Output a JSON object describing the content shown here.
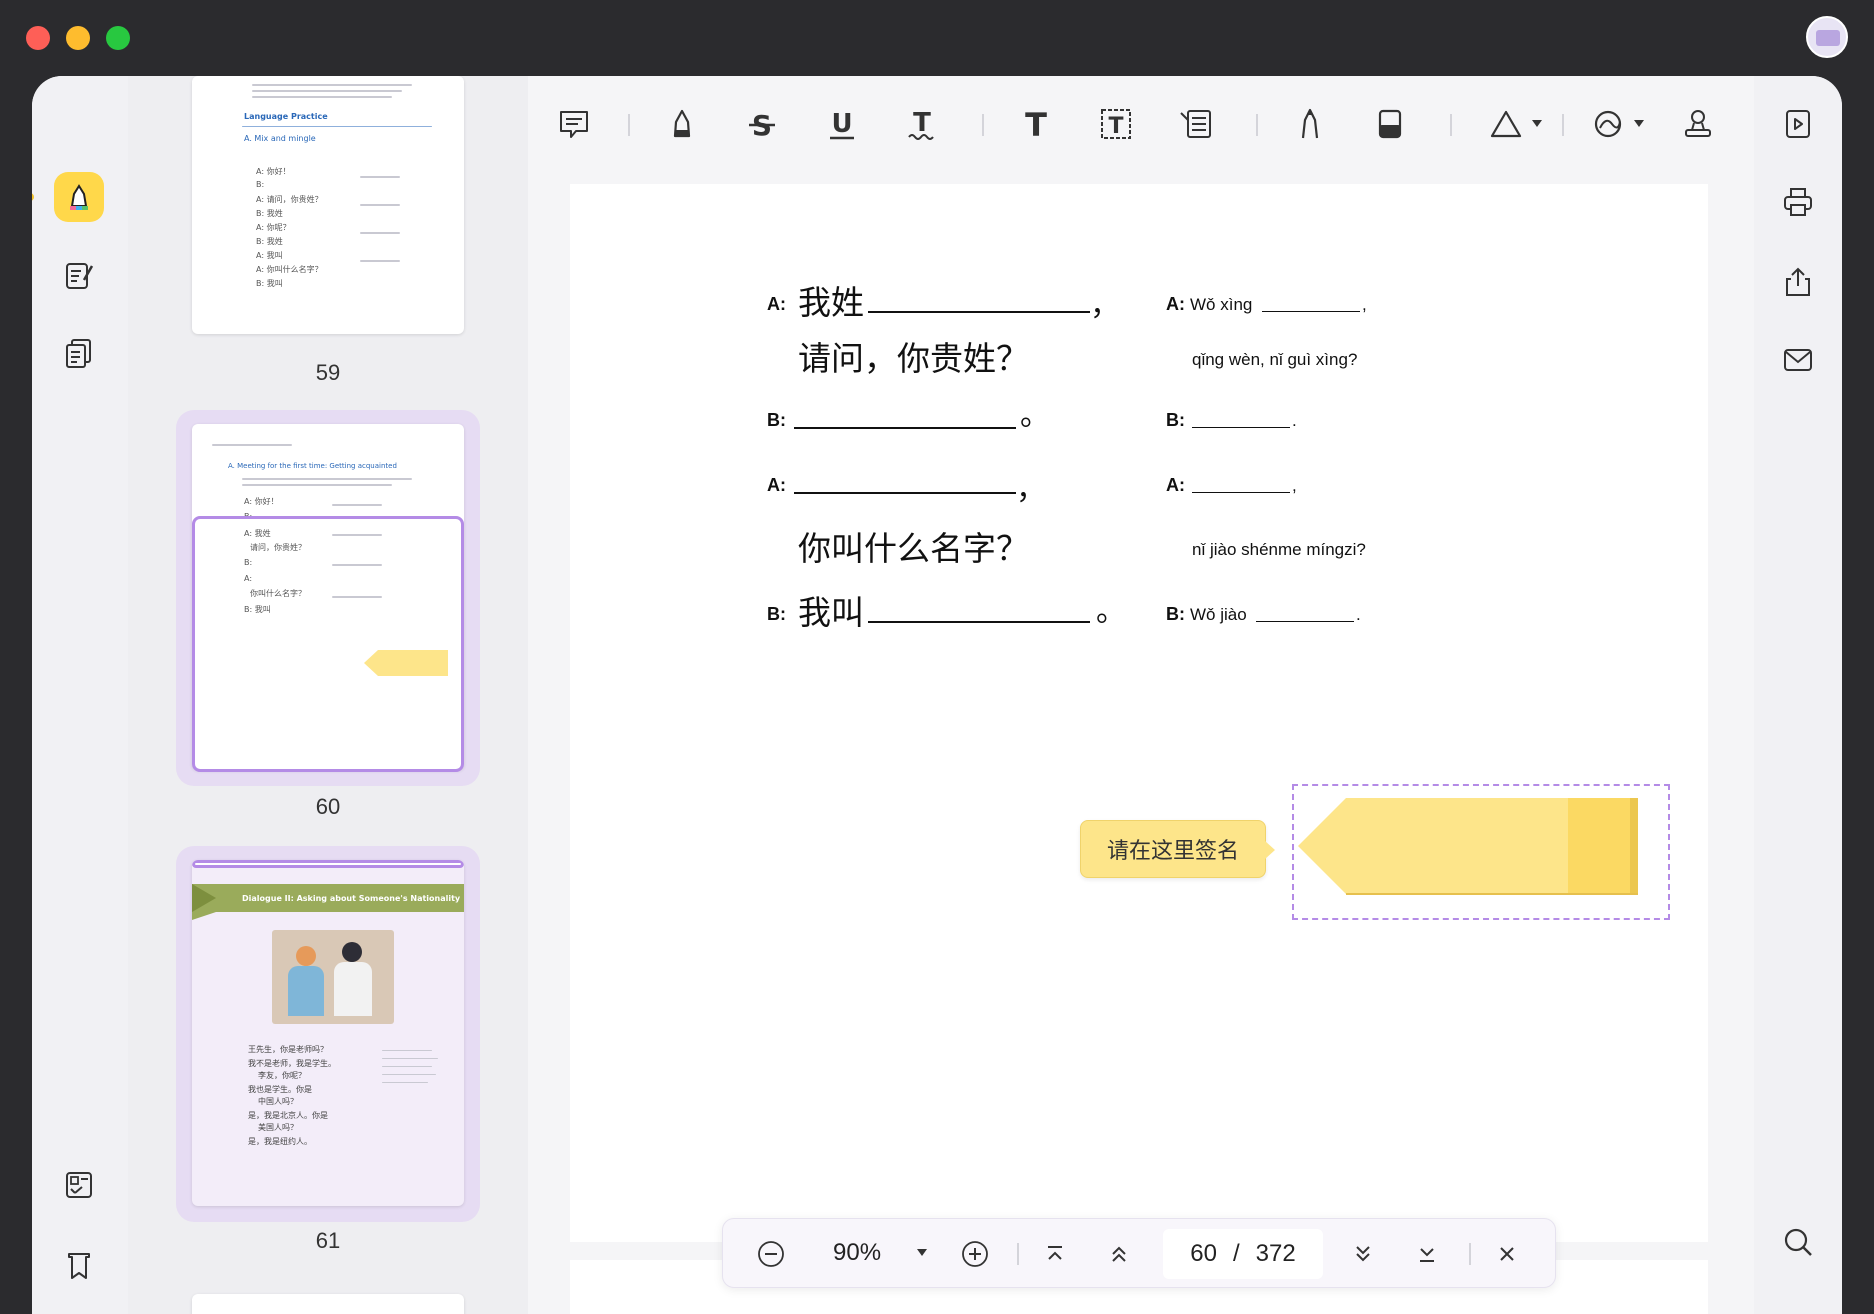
{
  "window": {
    "traffic_lights": [
      "close",
      "minimize",
      "zoom"
    ],
    "avatar_icon": "user-avatar-icon"
  },
  "left_rail": {
    "items": [
      {
        "name": "highlighter-icon",
        "active": true
      },
      {
        "name": "edit-pdf-icon",
        "active": false
      },
      {
        "name": "organize-pages-icon",
        "active": false
      },
      {
        "name": "thumbnails-icon",
        "active": false
      },
      {
        "name": "bookmark-icon",
        "active": false
      }
    ]
  },
  "thumbnails": [
    {
      "page": "59",
      "heading": "Language Practice",
      "section": "A. Mix and mingle",
      "lines": [
        "A: 你好！",
        "B:",
        "A: 请问，你贵姓？",
        "B: 我姓",
        "A: 你呢？",
        "B: 我姓",
        "A: 我叫",
        "A: 你叫什么名字？",
        "B: 我叫"
      ]
    },
    {
      "page": "60",
      "selected": true,
      "section": "A. Meeting for the first time: Getting acquainted",
      "lines": [
        "A: 你好！",
        "B:",
        "A: 我姓",
        "请问，你贵姓？",
        "B:",
        "A:",
        "你叫什么名字？",
        "B: 我叫"
      ]
    },
    {
      "page": "61",
      "banner": "Dialogue II: Asking about Someone's Nationality",
      "lines": [
        "王先生，你是老师吗？",
        "我不是老师，我是学生。",
        "李友，你呢？",
        "我也是学生。你是",
        "中国人吗？",
        "是，我是北京人。你是",
        "美国人吗？",
        "是，我是纽约人。"
      ]
    }
  ],
  "toolbar": {
    "tools": [
      "comment-icon",
      "highlight-icon",
      "strikethrough-icon",
      "underline-icon",
      "squiggly-icon",
      "text-icon",
      "textbox-icon",
      "text-callout-icon",
      "pencil-icon",
      "eraser-icon",
      "shape-icon",
      "signature-icon",
      "stamp-icon"
    ]
  },
  "document": {
    "left_column": {
      "a1_label": "A:",
      "a1_text": "我姓",
      "a1_mark": "，",
      "a1_line2": "请问，你贵姓？",
      "b1_label": "B:",
      "b1_mark": "。",
      "a2_label": "A:",
      "a2_mark": "，",
      "a2_line2": "你叫什么名字？",
      "b2_label": "B:",
      "b2_text": "我叫",
      "b2_mark": "。"
    },
    "right_column": {
      "a1_label": "A:",
      "a1_text": "Wǒ xìng",
      "a1_end": ",",
      "a1_line2": "qǐng wèn, nǐ guì xìng?",
      "b1_label": "B:",
      "b1_end": ".",
      "a2_label": "A:",
      "a2_end": ",",
      "a2_line2": "nǐ jiào shénme míngzi?",
      "b2_label": "B:",
      "b2_text": "Wǒ jiào",
      "b2_end": "."
    },
    "sign_tooltip": "请在这里签名",
    "sign_field_color": "#fde58a"
  },
  "zoombar": {
    "zoom": "90%",
    "current_page": "60",
    "separator": "/",
    "total_pages": "372"
  },
  "right_rail": {
    "items": [
      "slideshow-icon",
      "print-icon",
      "share-icon",
      "email-icon",
      "search-icon"
    ]
  },
  "colors": {
    "accent_purple": "#b48be6",
    "highlight_yellow": "#ffd84a",
    "selected_bg": "#e6dcf3"
  }
}
